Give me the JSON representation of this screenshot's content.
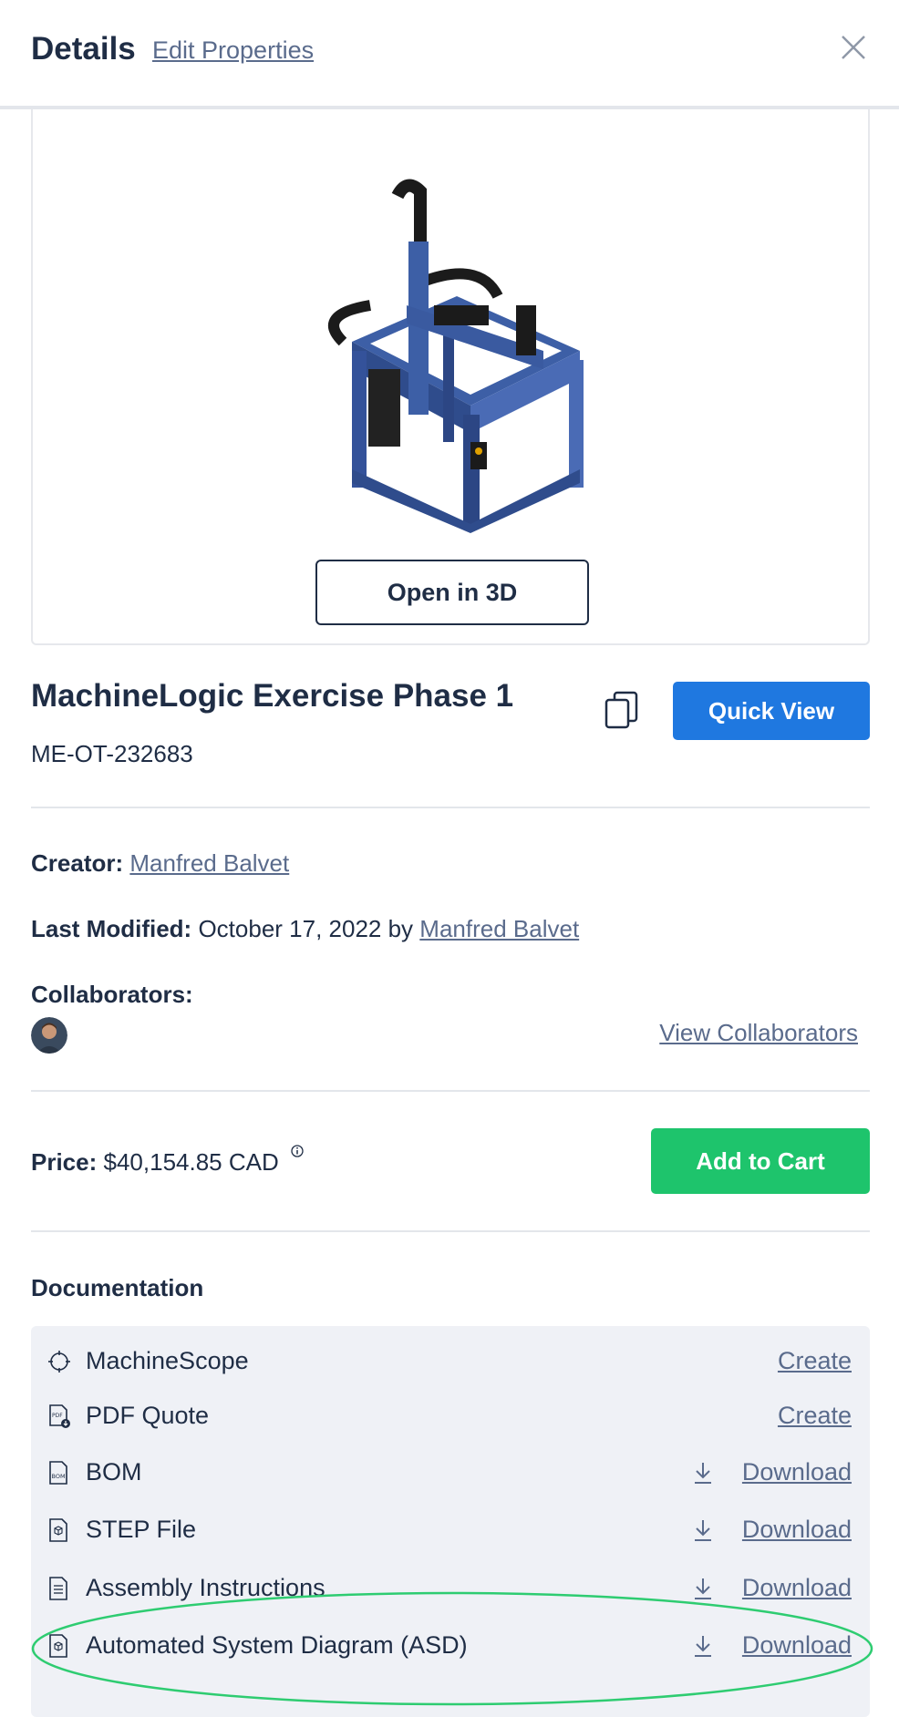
{
  "header": {
    "title": "Details",
    "edit_link": "Edit Properties",
    "close_icon": "close-icon"
  },
  "preview": {
    "open3d_label": "Open in 3D"
  },
  "product": {
    "title": "MachineLogic Exercise Phase 1",
    "id": "ME-OT-232683",
    "quickview_label": "Quick View"
  },
  "meta": {
    "creator_label": "Creator:",
    "creator_name": "Manfred Balvet",
    "modified_label": "Last Modified:",
    "modified_date": "October 17, 2022 by",
    "modified_by": "Manfred Balvet",
    "collaborators_label": "Collaborators:",
    "view_collaborators": "View Collaborators"
  },
  "price": {
    "label": "Price:",
    "value": "$40,154.85 CAD",
    "cart_label": "Add to Cart"
  },
  "documentation": {
    "title": "Documentation",
    "items": [
      {
        "label": "MachineScope",
        "action": "Create",
        "icon": "crosshair-icon"
      },
      {
        "label": "PDF Quote",
        "action": "Create",
        "icon": "pdf-icon"
      },
      {
        "label": "BOM",
        "action": "Download",
        "icon": "bom-file-icon"
      },
      {
        "label": "STEP File",
        "action": "Download",
        "icon": "step-file-icon"
      },
      {
        "label": "Assembly Instructions",
        "action": "Download",
        "icon": "list-file-icon"
      },
      {
        "label": "Automated System Diagram (ASD)",
        "action": "Download",
        "icon": "diagram-file-icon"
      }
    ]
  },
  "colors": {
    "primary_blue": "#1f78e0",
    "green": "#1ec46c",
    "text": "#1f2d45",
    "link": "#5a6b8c",
    "highlight": "#2ecc71"
  }
}
